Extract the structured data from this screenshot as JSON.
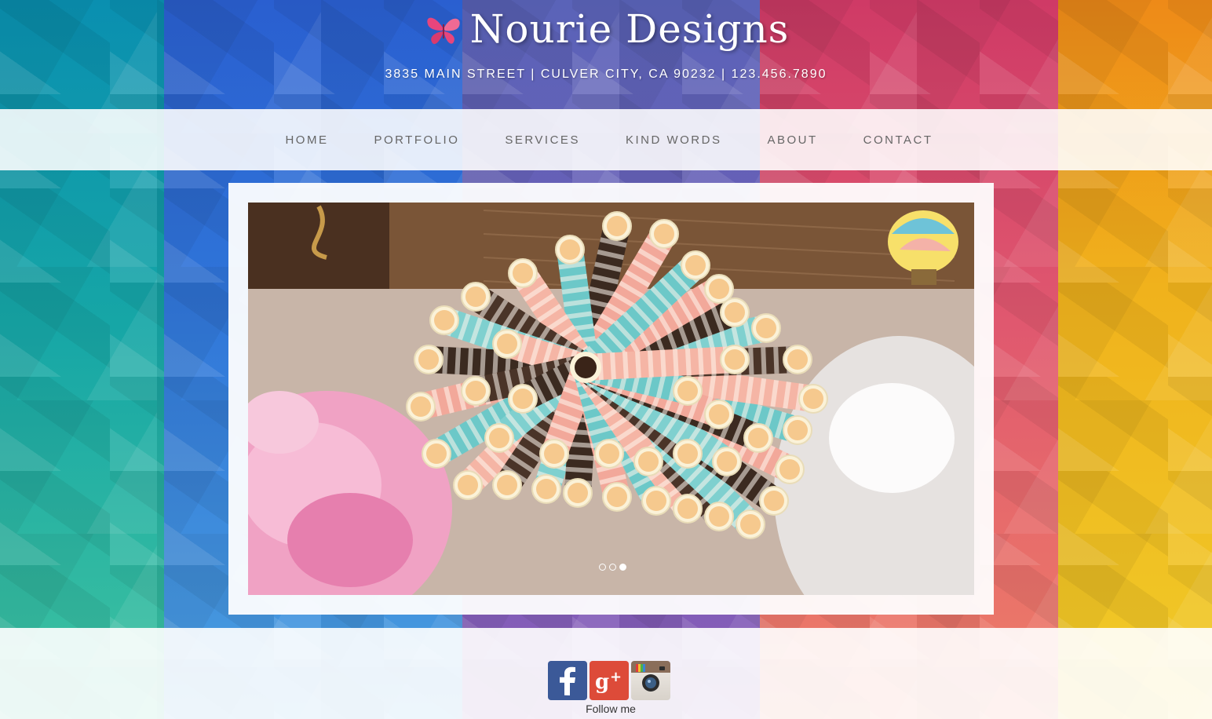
{
  "header": {
    "title": "Nourie Designs",
    "address": "3835 MAIN STREET | CULVER CITY, CA 90232 | 123.456.7890",
    "logo_icon": "butterfly-icon"
  },
  "nav": {
    "items": [
      {
        "label": "HOME"
      },
      {
        "label": "PORTFOLIO"
      },
      {
        "label": "SERVICES"
      },
      {
        "label": "KIND WORDS"
      },
      {
        "label": "ABOUT"
      },
      {
        "label": "CONTACT"
      }
    ]
  },
  "slider": {
    "slide_count": 3,
    "active_index": 2,
    "image": "paper-straws-photo"
  },
  "footer": {
    "social_icons": [
      "facebook-icon",
      "google-plus-icon",
      "instagram-icon"
    ],
    "follow_label": "Follow me"
  },
  "colors": {
    "stripe_teal": "#0a8fb0",
    "stripe_blue": "#2a5fd0",
    "stripe_purple": "#5a63b8",
    "stripe_pink": "#cf3a66",
    "stripe_orange": "#ee8a18",
    "nav_text": "#666666",
    "facebook": "#3b5998",
    "google_plus": "#dd4b39"
  }
}
